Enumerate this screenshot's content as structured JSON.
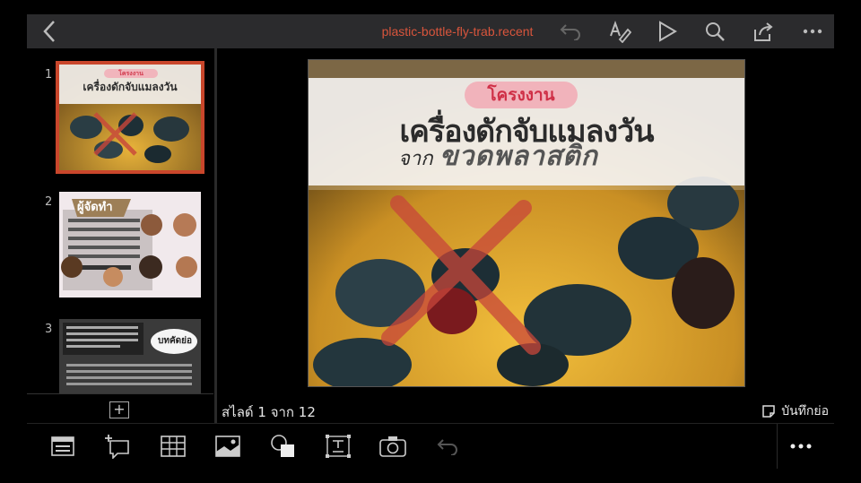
{
  "toolbar": {
    "document_title": "plastic-bottle-fly-trab.recent",
    "icons": [
      "back-chevron-icon",
      "undo-icon",
      "format-pen-icon",
      "play-icon",
      "search-icon",
      "share-icon",
      "more-icon"
    ]
  },
  "sidebar": {
    "slides": [
      {
        "number": "1",
        "title": "เครื่องดักจับแมลงวัน",
        "tag": "โครงงาน"
      },
      {
        "number": "2",
        "title": "ผู้จัดทำ"
      },
      {
        "number": "3",
        "title": "บทคัดย่อ"
      }
    ],
    "add_label": "+"
  },
  "slide": {
    "tag": "โครงงาน",
    "title": "เครื่องดักจับแมลงวัน",
    "subtitle_small": "จาก",
    "subtitle_big": "ขวดพลาสติก"
  },
  "status": {
    "slide_counter": "สไลด์ 1 จาก 12",
    "notes_label": "บันทึกย่อ"
  },
  "bottom_toolbar": {
    "icons": [
      "layout-icon",
      "comment-icon",
      "table-icon",
      "image-icon",
      "shapes-icon",
      "textbox-icon",
      "camera-icon",
      "undo-icon",
      "more-icon"
    ]
  },
  "colors": {
    "accent": "#d8553c",
    "selected_border": "#c9462b",
    "toolbar_bg": "#2b2b2d"
  }
}
